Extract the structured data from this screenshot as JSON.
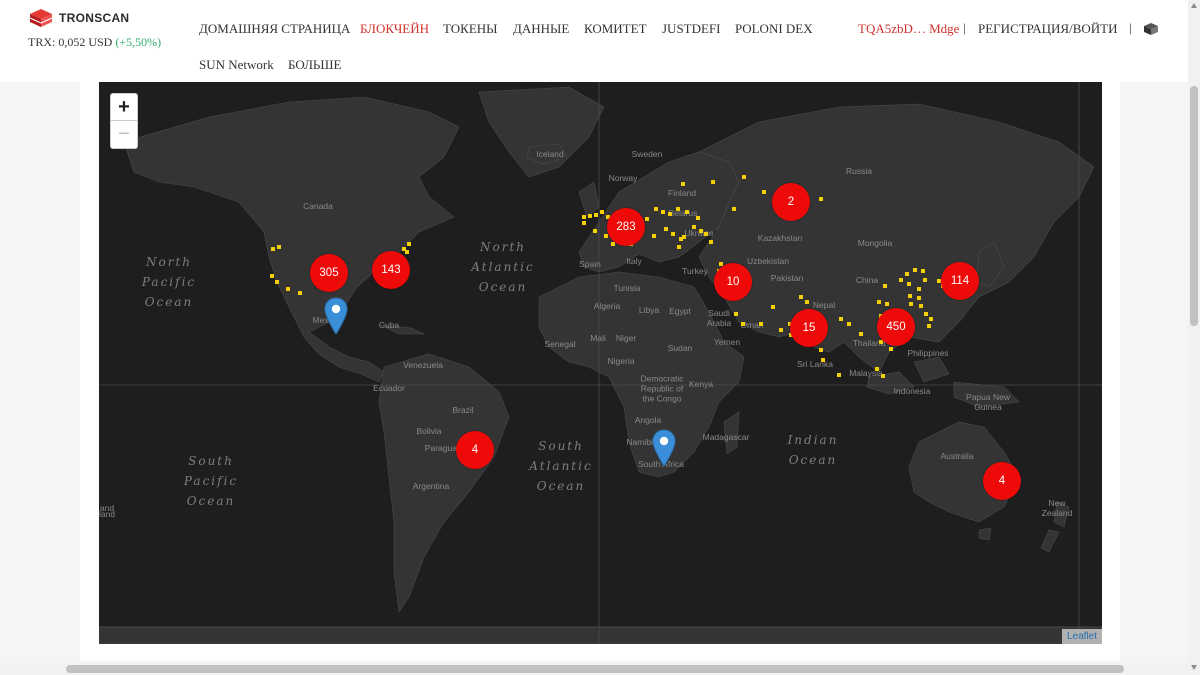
{
  "header": {
    "logo_text": "TRONSCAN",
    "price_text": "TRX: 0,052 USD",
    "price_change": "(+5,50%)",
    "nav": [
      {
        "label": "ДОМАШНЯЯ СТРАНИЦА",
        "active": false
      },
      {
        "label": "БЛОКЧЕЙН",
        "active": true
      },
      {
        "label": "ТОКЕНЫ",
        "active": false
      },
      {
        "label": "ДАННЫЕ",
        "active": false
      },
      {
        "label": "КОМИТЕТ",
        "active": false
      },
      {
        "label": "JUSTDEFI",
        "active": false
      },
      {
        "label": "POLONI DEX",
        "active": false
      },
      {
        "label": "SUN Network",
        "active": false
      },
      {
        "label": "БОЛЬШЕ",
        "active": false
      }
    ],
    "account": "TQA5zbD… Mdge",
    "separator": "|",
    "login": "РЕГИСТРАЦИЯ/ВОЙТИ",
    "accent_color": "#d0312d"
  },
  "map": {
    "zoom_in": "+",
    "zoom_out": "−",
    "attribution": "Leaflet",
    "cluster_color": "#ef0a0a",
    "node_color": "#f5d000",
    "marker_color": "#3a8fd8",
    "oceans": {
      "north_pacific": "North\nPacific\nOcean",
      "north_atlantic": "North\nAtlantic\nOcean",
      "south_atlantic": "South\nAtlantic\nOcean",
      "south_pacific": "South\nPacific\nOcean",
      "indian": "Indian\nOcean"
    },
    "places": {
      "canada": "Canada",
      "iceland": "Iceland",
      "sweden": "Sweden",
      "norway": "Norway",
      "russia": "Russia",
      "finland": "Finland",
      "belarus": "Belarus",
      "ukraine": "Ukraine",
      "kazakhstan": "Kazakhstan",
      "mongolia": "Mongolia",
      "uzbekistan": "Uzbekistan",
      "turkey": "Turkey",
      "spain": "Spain",
      "italy": "Italy",
      "france": "France",
      "tunisia": "Tunisia",
      "algeria": "Algeria",
      "libya": "Libya",
      "egypt": "Egypt",
      "saudi_arabia": "Saudi\nArabia",
      "oman": "Oman",
      "yemen": "Yemen",
      "pakistan": "Pakistan",
      "nepal": "Nepal",
      "china": "China",
      "thailand": "Thailand",
      "philippines": "Philippines",
      "malaysia": "Malaysia",
      "indonesia": "Indonesia",
      "sri_lanka": "Sri Lanka",
      "papua_new_guinea": "Papua New\nGuinea",
      "mexico": "Mexico",
      "cuba": "Cuba",
      "venezuela": "Venezuela",
      "ecuador": "Ecuador",
      "brazil": "Brazil",
      "bolivia": "Bolivia",
      "paraguay": "Paraguay",
      "argentina": "Argentina",
      "senegal": "Senegal",
      "mali": "Mali",
      "niger": "Niger",
      "nigeria": "Nigeria",
      "sudan": "Sudan",
      "drc": "Democratic\nRepublic of\nthe Congo",
      "kenya": "Kenya",
      "angola": "Angola",
      "namibia": "Namibia",
      "south_africa": "South Africa",
      "madagascar": "Madagascar",
      "australia": "Australia",
      "new_zealand": "New\nZealand",
      "nd_edge": "and",
      "land_edge": "land"
    },
    "clusters": {
      "c305": "305",
      "c143": "143",
      "c283": "283",
      "c2": "2",
      "c10": "10",
      "c15": "15",
      "c450": "450",
      "c114": "114",
      "c4_sa": "4",
      "c4_au": "4"
    }
  }
}
